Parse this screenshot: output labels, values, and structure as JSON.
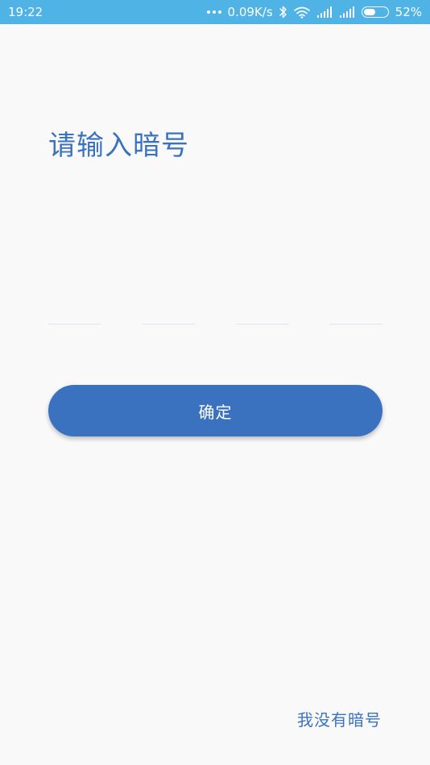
{
  "status_bar": {
    "time": "19:22",
    "network_speed": "0.09K/s",
    "battery_percent": "52%",
    "battery_level": 0.52,
    "icons": [
      "more-dots-icon",
      "bluetooth-icon",
      "wifi-icon",
      "signal-icon",
      "signal-icon",
      "battery-icon"
    ]
  },
  "page": {
    "title": "请输入暗号",
    "code_slots": [
      {
        "value": "",
        "placeholder": ""
      },
      {
        "value": "",
        "placeholder": ""
      },
      {
        "value": "",
        "placeholder": ""
      },
      {
        "value": "",
        "placeholder": ""
      }
    ],
    "confirm_label": "确定",
    "no_code_label": "我没有暗号"
  },
  "colors": {
    "status_bar_bg": "#4fb3e6",
    "accent": "#3b72c0",
    "background": "#f9f9f9",
    "input_underline": "#dde4ee"
  }
}
